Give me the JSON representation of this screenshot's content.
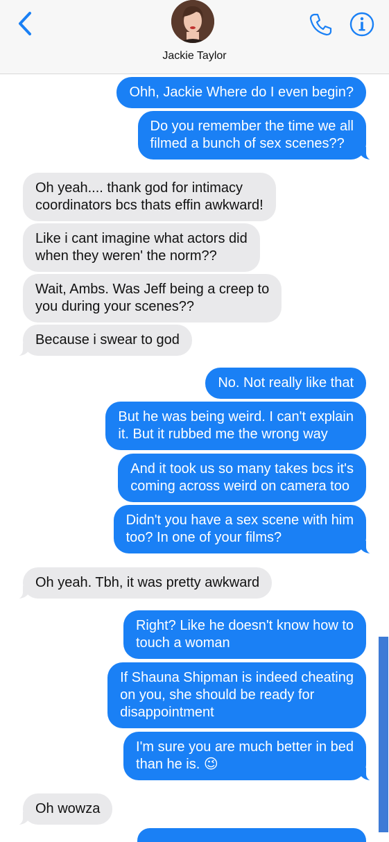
{
  "header": {
    "contact_name": "Jackie Taylor",
    "back_icon": "chevron-left-icon",
    "call_icon": "phone-icon",
    "info_icon": "info-icon",
    "accent_color": "#1a80f5"
  },
  "messages": [
    {
      "side": "sent",
      "text": "Ohh, Jackie Where do I even begin?"
    },
    {
      "side": "sent",
      "text": "Do you remember the time we all\nfilmed a bunch of sex scenes??"
    },
    {
      "side": "received",
      "text": "Oh yeah.... thank god for intimacy\ncoordinators bcs thats effin awkward!"
    },
    {
      "side": "received",
      "text": "Like i cant imagine what actors did\nwhen they weren' the norm??"
    },
    {
      "side": "received",
      "text": "Wait, Ambs. Was Jeff being a creep to\nyou during your scenes??"
    },
    {
      "side": "received",
      "text": "Because i swear to god"
    },
    {
      "side": "sent",
      "text": "No. Not really like that"
    },
    {
      "side": "sent",
      "text": "But he was being weird. I can't explain\nit. But it rubbed me the wrong way"
    },
    {
      "side": "sent",
      "text": "And it took us so many takes bcs it's\ncoming across weird on camera too"
    },
    {
      "side": "sent",
      "text": "Didn't you have a sex scene with him\ntoo? In one of your films?"
    },
    {
      "side": "received",
      "text": "Oh yeah. Tbh, it was pretty awkward"
    },
    {
      "side": "sent",
      "text": "Right? Like he doesn't know how to\ntouch a woman"
    },
    {
      "side": "sent",
      "text": "If Shauna Shipman is indeed cheating\non you, she should be ready for\ndisappointment"
    },
    {
      "side": "sent",
      "text": "I'm sure you are much better in bed\nthan he is. 😉"
    },
    {
      "side": "received",
      "text": "Oh wowza"
    }
  ],
  "colors": {
    "sent_bubble": "#1a80f5",
    "received_bubble": "#e9e9eb",
    "scrollbar": "#3d7bd6"
  }
}
